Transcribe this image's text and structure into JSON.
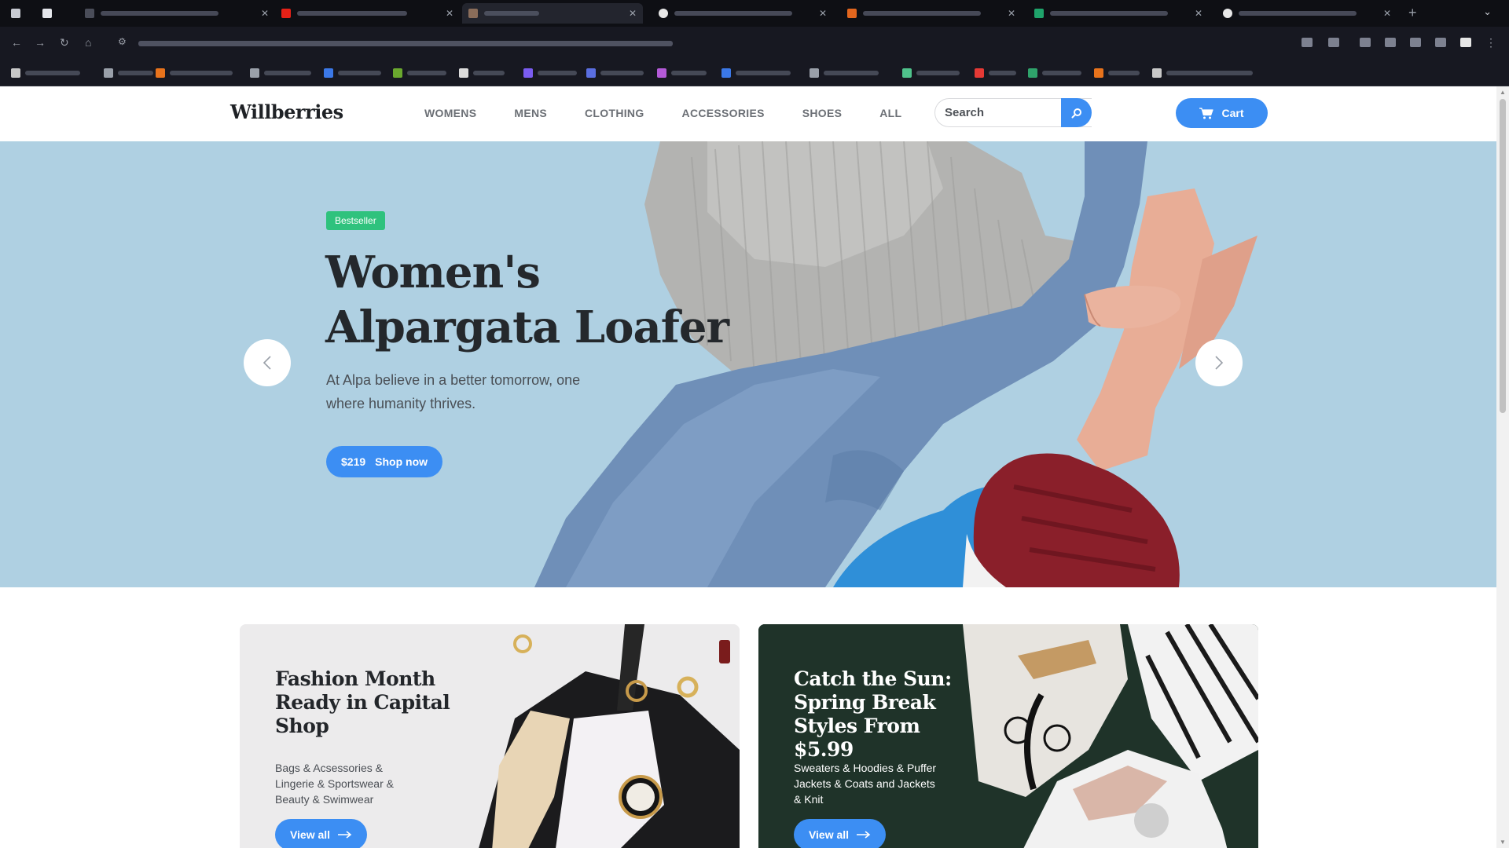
{
  "browser": {
    "new_tab_icon": "plus-icon",
    "tab_list_icon": "chevron-down-icon"
  },
  "header": {
    "logo": "Willberries",
    "nav": [
      {
        "label": "WOMENS"
      },
      {
        "label": "MENS"
      },
      {
        "label": "CLOTHING"
      },
      {
        "label": "ACCESSORIES"
      },
      {
        "label": "SHOES"
      },
      {
        "label": "ALL"
      }
    ],
    "search_placeholder": "Search",
    "cart_label": "Cart"
  },
  "hero": {
    "badge": "Bestseller",
    "title": "Women's Alpargata Loafer",
    "description": "At Alpa believe in a better tomorrow, one where humanity thrives.",
    "price": "$219",
    "button_label": "Shop now"
  },
  "promos": [
    {
      "title": "Fashion Month Ready in Capital Shop",
      "description": "Bags & Acsessories & Lingerie & Sportswear & Beauty & Swimwear",
      "button_label": "View all"
    },
    {
      "title": "Catch the Sun: Spring Break Styles From $5.99",
      "description": "Sweaters & Hoodies & Puffer Jackets & Coats and Jackets & Knit",
      "button_label": "View all"
    }
  ],
  "colors": {
    "accent": "#3c8ef3",
    "badge": "#2fc27d",
    "hero_bg": "#afd0e2"
  }
}
